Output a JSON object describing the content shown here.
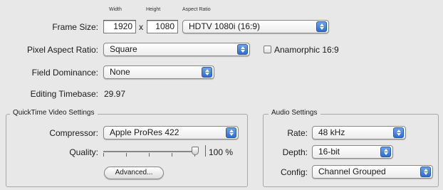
{
  "frame_size": {
    "label": "Frame Size:",
    "width_caption": "Width",
    "height_caption": "Height",
    "aspect_caption": "Aspect Ratio",
    "width": "1920",
    "times": "x",
    "height": "1080",
    "aspect": "HDTV 1080i (16:9)"
  },
  "pixel_aspect": {
    "label": "Pixel Aspect Ratio:",
    "value": "Square",
    "anamorphic_label": "Anamorphic 16:9",
    "anamorphic_checked": false
  },
  "field_dominance": {
    "label": "Field Dominance:",
    "value": "None"
  },
  "editing_timebase": {
    "label": "Editing Timebase:",
    "value": "29.97"
  },
  "qt_video": {
    "title": "QuickTime Video Settings",
    "compressor_label": "Compressor:",
    "compressor": "Apple ProRes 422",
    "quality_label": "Quality:",
    "quality_value": "100 %",
    "quality_fraction": 1.0,
    "advanced_label": "Advanced..."
  },
  "audio": {
    "title": "Audio Settings",
    "rate_label": "Rate:",
    "rate": "48 kHz",
    "depth_label": "Depth:",
    "depth": "16-bit",
    "config_label": "Config:",
    "config": "Channel Grouped"
  }
}
